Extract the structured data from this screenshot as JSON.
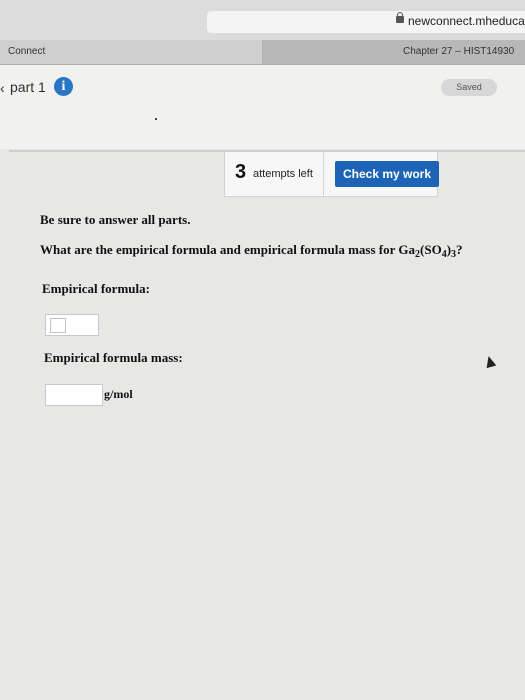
{
  "browser": {
    "url": "newconnect.mheduca",
    "tabs": [
      {
        "label": "Connect"
      },
      {
        "label": "Chapter 27 – HIST14930"
      }
    ]
  },
  "header": {
    "back_glyph": "‹",
    "part_label": "part 1",
    "info_glyph": "i",
    "saved_label": "Saved"
  },
  "toolbar": {
    "attempts_count": "3",
    "attempts_label": "attempts left",
    "check_label": "Check my work"
  },
  "question": {
    "instruction": "Be sure to answer all parts.",
    "prompt_start": "What are the empirical formula and empirical formula mass for Ga",
    "formula_sub1": "2",
    "formula_mid": "(SO",
    "formula_sub2": "4",
    "formula_close": ")",
    "formula_sub3": "3",
    "prompt_end": "?",
    "empirical_formula_label": "Empirical formula:",
    "empirical_formula_value": "",
    "formula_mass_label": "Empirical formula mass:",
    "formula_mass_value": "",
    "formula_mass_unit": "g/mol"
  }
}
